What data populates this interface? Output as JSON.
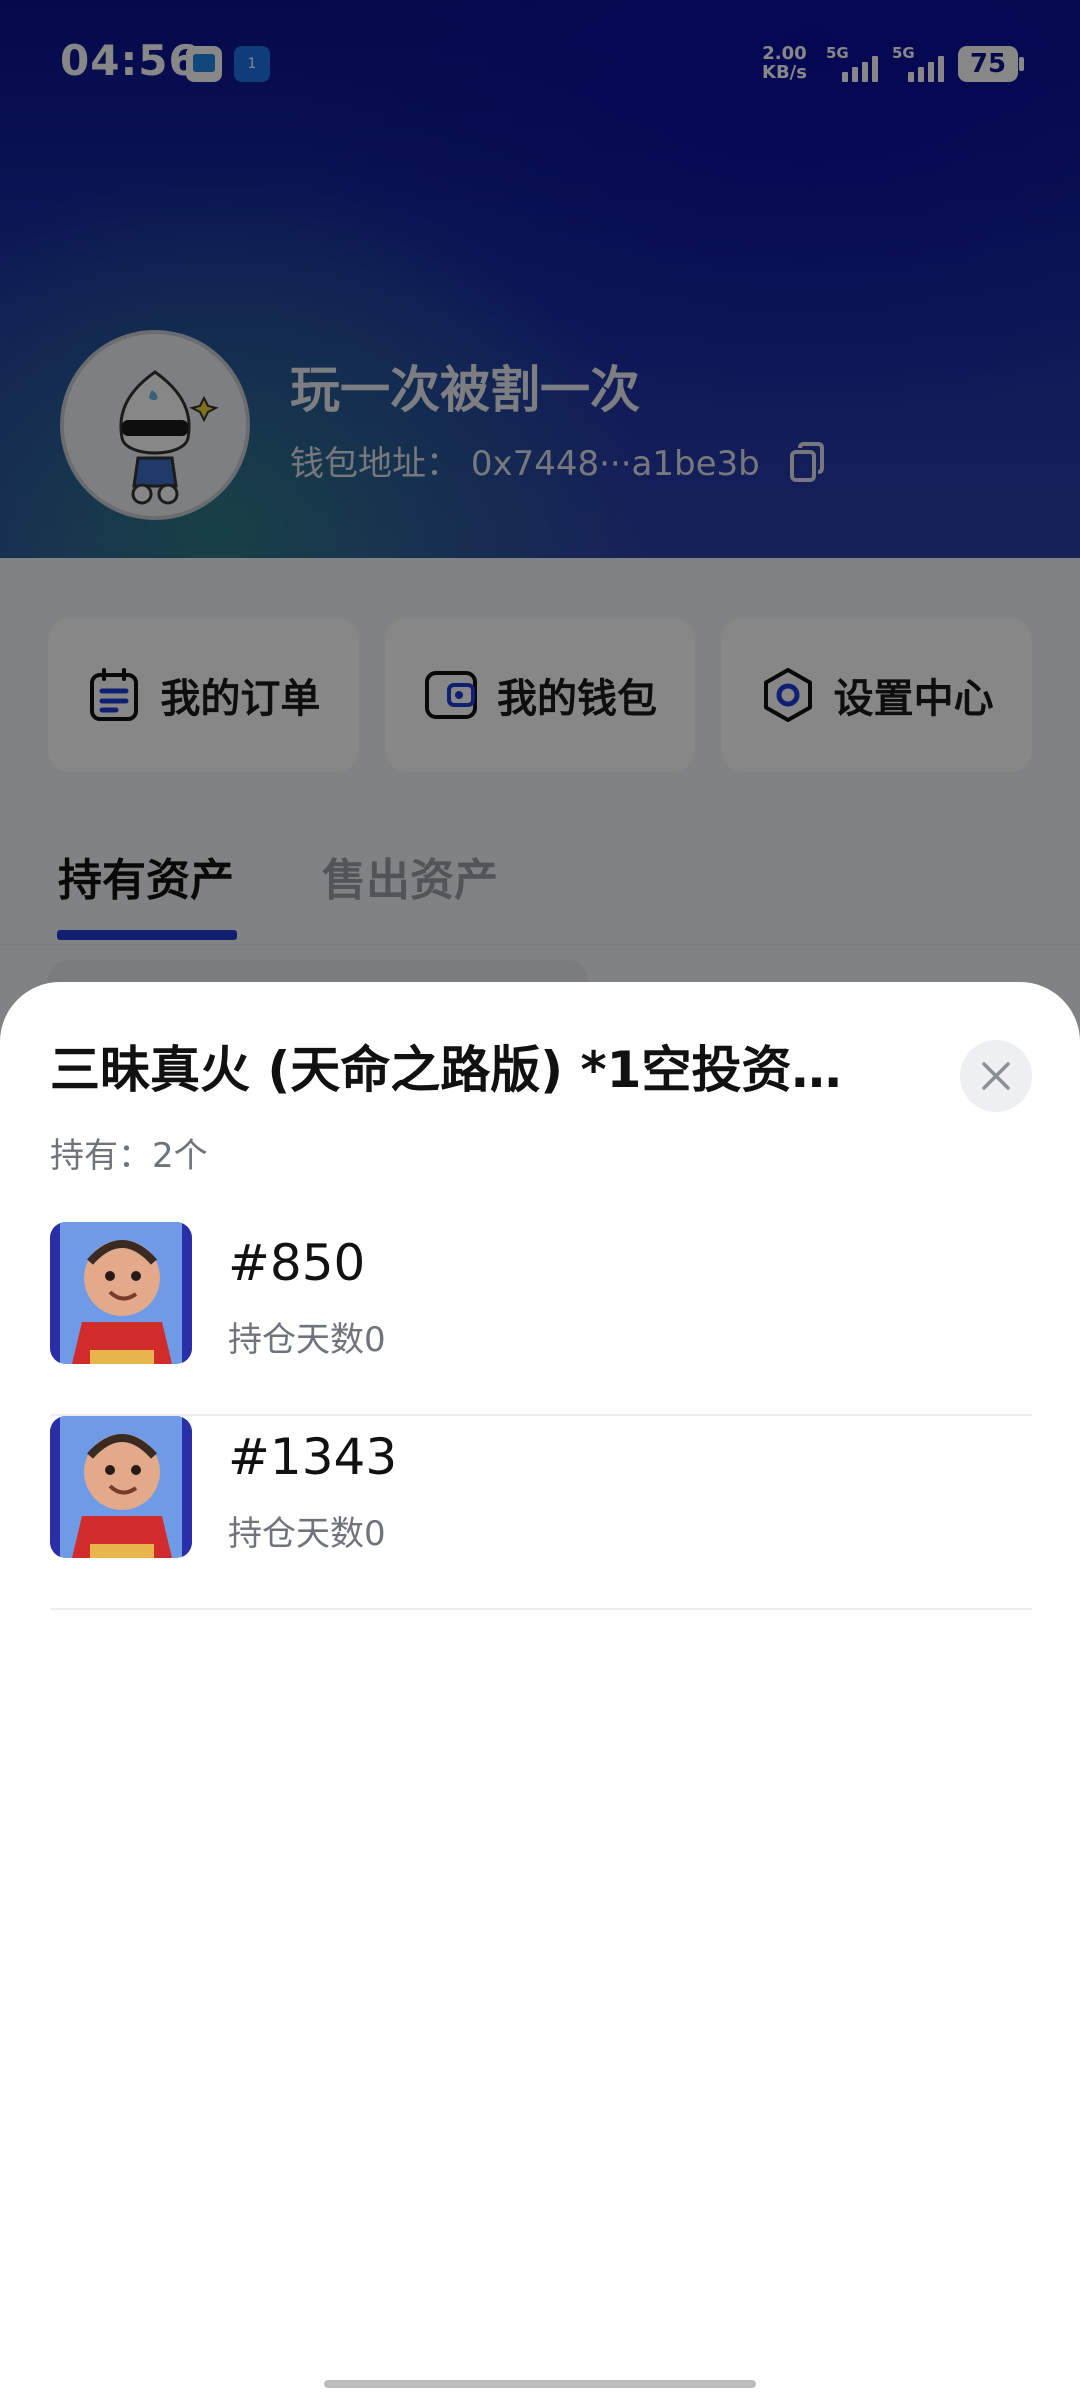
{
  "status_bar": {
    "time": "04:56",
    "app2_badge": "1",
    "net_speed_value": "2.00",
    "net_speed_unit": "KB/s",
    "signal1_label": "5G",
    "signal2_label": "5G",
    "battery": "75"
  },
  "profile": {
    "name": "玩一次被割一次",
    "wallet_label": "钱包地址：",
    "wallet_address": "0x7448···a1be3b"
  },
  "quick_actions": [
    {
      "label": "我的订单",
      "icon": "order-icon"
    },
    {
      "label": "我的钱包",
      "icon": "wallet-icon"
    },
    {
      "label": "设置中心",
      "icon": "settings-icon"
    }
  ],
  "tabs": [
    {
      "label": "持有资产",
      "active": true
    },
    {
      "label": "售出资产",
      "active": false
    }
  ],
  "sheet": {
    "title": "三昧真火 (天命之路版) *1空投资…",
    "holding": "持有：2个",
    "items": [
      {
        "id": "#850",
        "days": "持仓天数0"
      },
      {
        "id": "#1343",
        "days": "持仓天数0"
      }
    ]
  },
  "colors": {
    "accent": "#1f3bd6",
    "header_dark": "#0b1290"
  }
}
